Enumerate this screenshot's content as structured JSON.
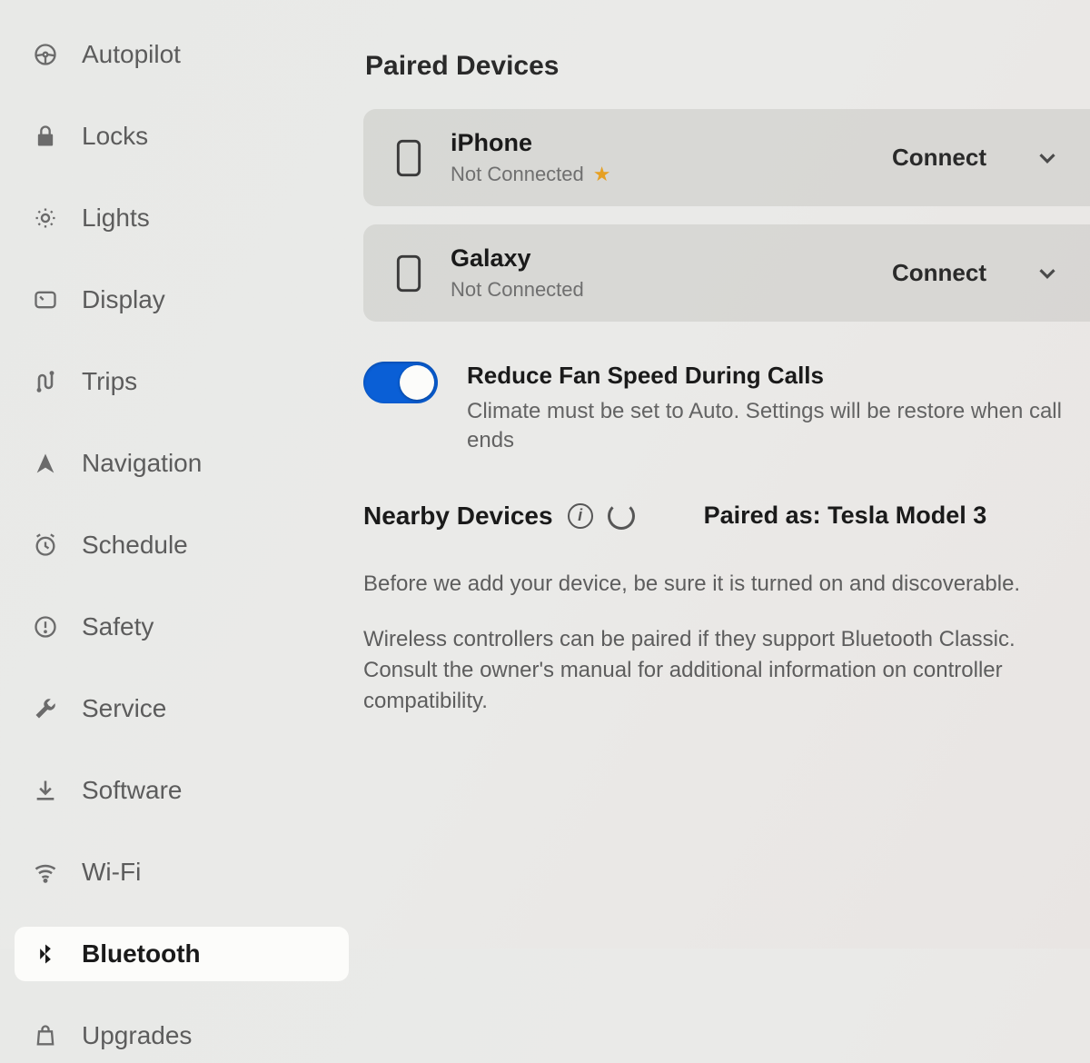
{
  "sidebar": {
    "items": [
      {
        "label": "Autopilot",
        "icon": "steering-wheel-icon",
        "active": false
      },
      {
        "label": "Locks",
        "icon": "lock-icon",
        "active": false
      },
      {
        "label": "Lights",
        "icon": "brightness-icon",
        "active": false
      },
      {
        "label": "Display",
        "icon": "display-icon",
        "active": false
      },
      {
        "label": "Trips",
        "icon": "route-icon",
        "active": false
      },
      {
        "label": "Navigation",
        "icon": "nav-arrow-icon",
        "active": false
      },
      {
        "label": "Schedule",
        "icon": "alarm-icon",
        "active": false
      },
      {
        "label": "Safety",
        "icon": "exclamation-circle-icon",
        "active": false
      },
      {
        "label": "Service",
        "icon": "wrench-icon",
        "active": false
      },
      {
        "label": "Software",
        "icon": "download-icon",
        "active": false
      },
      {
        "label": "Wi-Fi",
        "icon": "wifi-icon",
        "active": false
      },
      {
        "label": "Bluetooth",
        "icon": "bluetooth-icon",
        "active": true
      },
      {
        "label": "Upgrades",
        "icon": "bag-icon",
        "active": false
      }
    ]
  },
  "main": {
    "paired_devices_title": "Paired Devices",
    "devices": [
      {
        "name": "iPhone",
        "status": "Not Connected",
        "favorite": true,
        "action": "Connect"
      },
      {
        "name": "Galaxy",
        "status": "Not Connected",
        "favorite": false,
        "action": "Connect"
      }
    ],
    "fan_toggle": {
      "on": true,
      "title": "Reduce Fan Speed During Calls",
      "description": "Climate must be set to Auto. Settings will be restore when call ends"
    },
    "nearby": {
      "label": "Nearby Devices",
      "paired_as_label": "Paired as:",
      "paired_as_value": "Tesla Model 3"
    },
    "help": {
      "p1": "Before we add your device, be sure it is turned on and discoverable.",
      "p2": "Wireless controllers can be paired if they support Bluetooth Classic. Consult the owner's manual for additional information on controller compatibility."
    },
    "colors": {
      "toggle_active": "#0a5fd6",
      "star": "#e6a023"
    }
  }
}
